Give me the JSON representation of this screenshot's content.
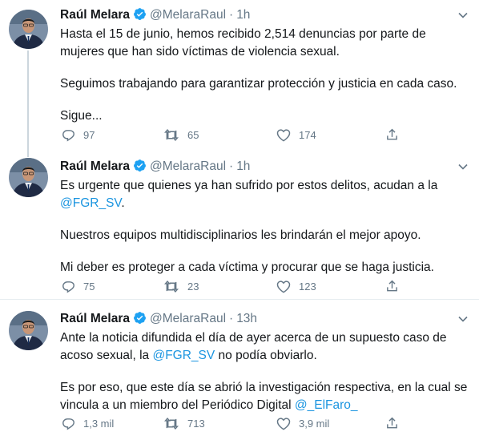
{
  "tweets": [
    {
      "author_name": "Raúl Melara",
      "handle": "@MelaraRaul",
      "separator": "·",
      "time": "1h",
      "lines": [
        "Hasta el 15 de junio, hemos recibido 2,514 denuncias por parte de",
        "mujeres que han sido víctimas de violencia sexual.",
        "",
        "Seguimos trabajando para garantizar protección y justicia en cada caso.",
        "",
        "Sigue..."
      ],
      "replies": "97",
      "retweets": "65",
      "likes": "174"
    },
    {
      "author_name": "Raúl Melara",
      "handle": "@MelaraRaul",
      "separator": "·",
      "time": "1h",
      "line1": "Es urgente que quienes ya han sufrido por estos delitos, acudan a la",
      "mention": "@FGR_SV",
      "mention_suffix": ".",
      "line3": "Nuestros equipos multidisciplinarios les  brindarán el mejor apoyo.",
      "line4": "Mi deber es proteger a cada víctima y procurar que se haga justicia.",
      "replies": "75",
      "retweets": "23",
      "likes": "123"
    },
    {
      "author_name": "Raúl Melara",
      "handle": "@MelaraRaul",
      "separator": "·",
      "time": "13h",
      "line1": "Ante la noticia difundida el día de ayer acerca de un supuesto caso de",
      "line2_prefix": "acoso sexual, la ",
      "mention": "@FGR_SV",
      "line2_suffix": " no podía obviarlo.",
      "line3": "Es por eso, que este día se abrió la investigación respectiva,  en la cual se",
      "line4_prefix": "vincula a un miembro del Periódico Digital ",
      "mention2": "@_ElFaro_",
      "replies": "1,3 mil",
      "retweets": "713",
      "likes": "3,9 mil"
    }
  ],
  "icons": {
    "verified": "verified-badge-icon",
    "caret": "chevron-down-icon",
    "reply": "reply-icon",
    "retweet": "retweet-icon",
    "like": "heart-icon",
    "share": "share-icon"
  },
  "colors": {
    "link": "#1b95e0",
    "verified": "#1da1f2",
    "muted": "#657786",
    "divider": "#e6ecf0"
  }
}
